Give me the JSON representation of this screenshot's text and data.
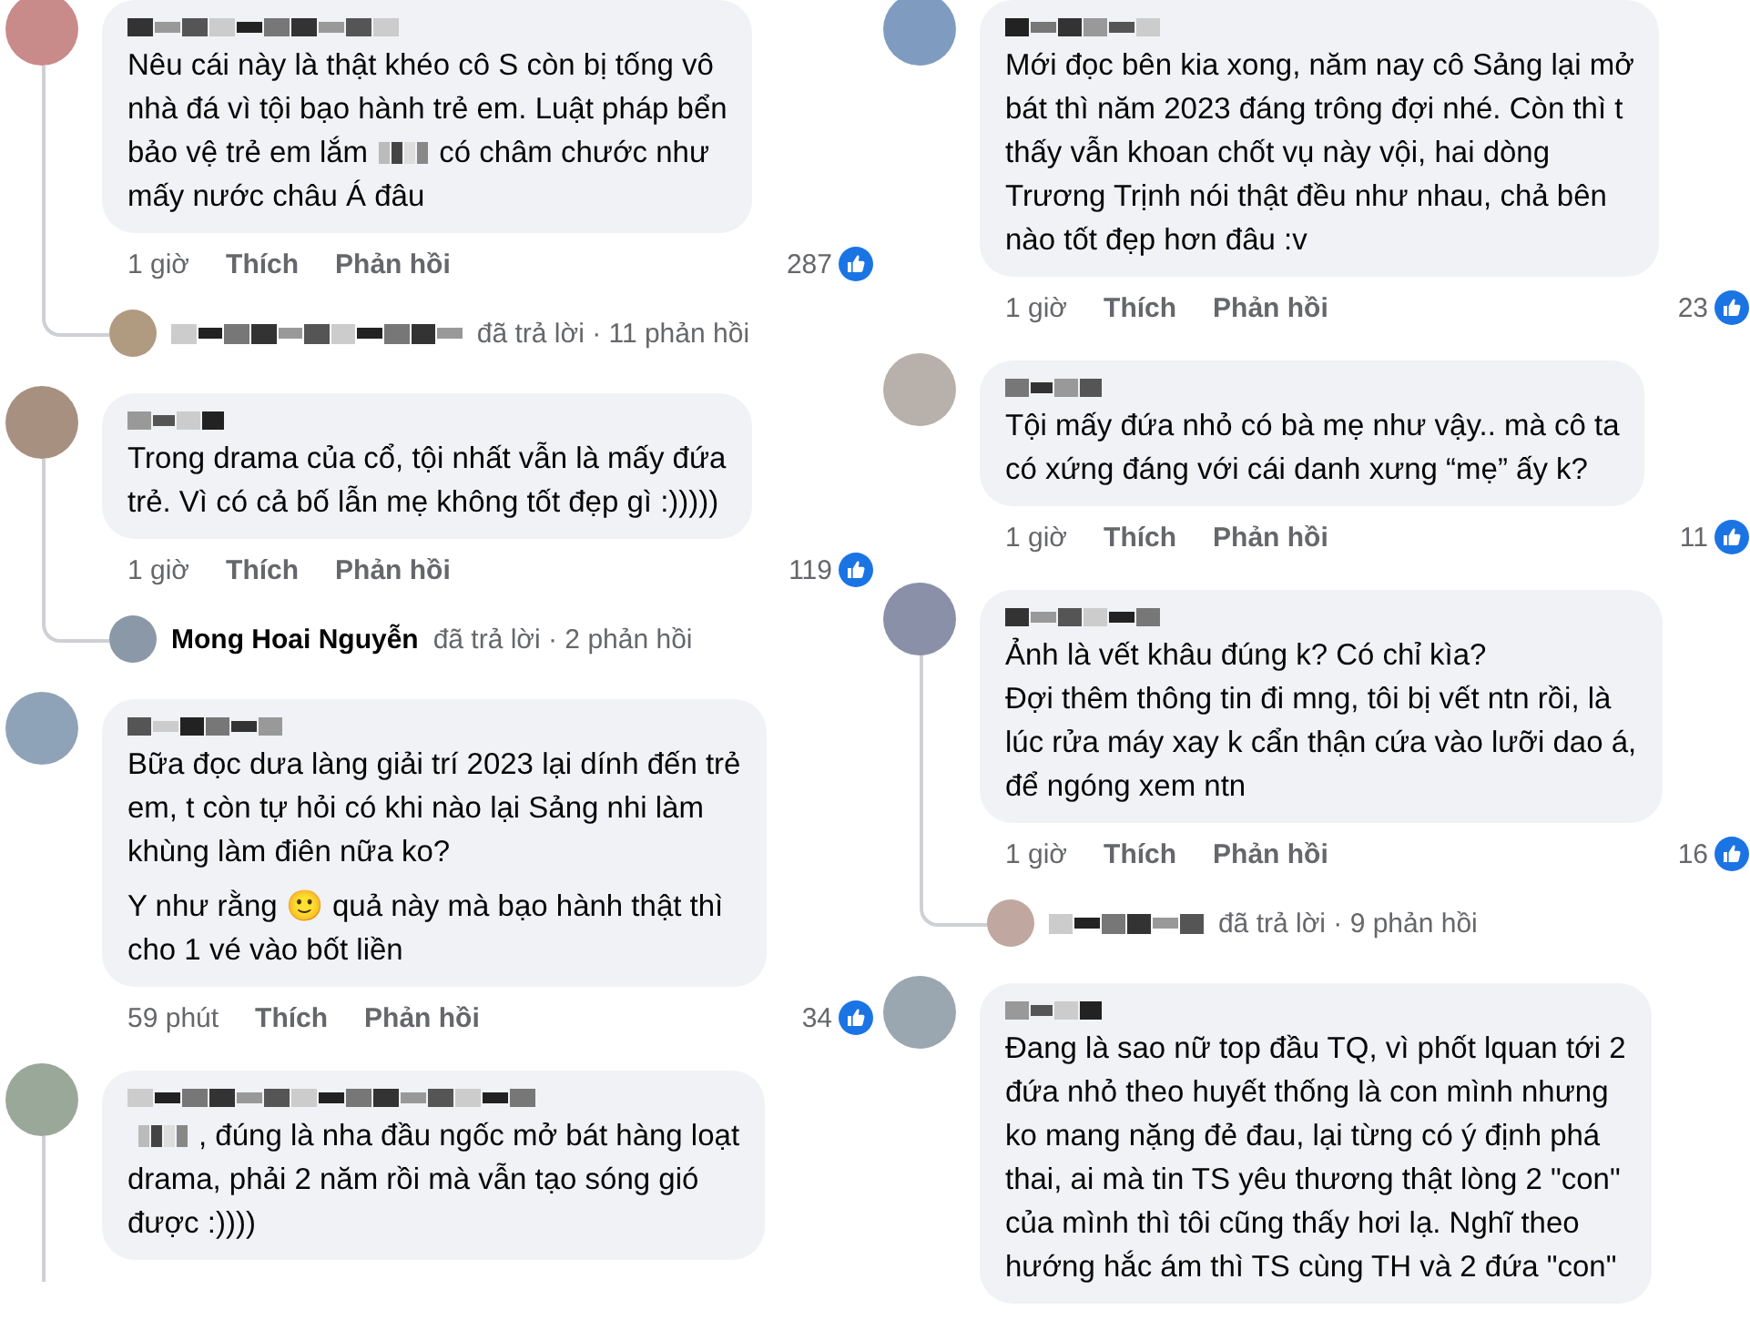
{
  "columns": [
    {
      "comments": [
        {
          "author": {
            "redacted": true
          },
          "paragraphs": [
            [
              {
                "kind": "text",
                "lines": [
                  "Nêu cái này là thật khéo cô S còn bị tống vô",
                  "nhà đá vì tội bạo hành trẻ em. Luật pháp bển"
                ]
              },
              {
                "kind": "row",
                "parts": [
                  {
                    "kind": "text",
                    "text": "bảo vệ trẻ em lắm"
                  },
                  {
                    "kind": "redacted"
                  },
                  {
                    "kind": "text",
                    "text": "có châm chước như"
                  }
                ]
              },
              {
                "kind": "text",
                "lines": [
                  "mấy nước châu Á đâu"
                ]
              }
            ]
          ],
          "time": "1 giờ",
          "actions": [
            "Thích",
            "Phản hồi"
          ],
          "likes": "287",
          "thread_line": true,
          "reply": {
            "author": {
              "redacted": true
            },
            "summary": "đã trả lời · 11 phản hồi"
          }
        },
        {
          "author": {
            "redacted": true
          },
          "paragraphs": [
            [
              {
                "kind": "text",
                "lines": [
                  "Trong drama của cổ, tội nhất vẫn là mấy đứa",
                  "trẻ. Vì có cả bố lẫn mẹ không tốt đẹp gì :)))))"
                ]
              }
            ]
          ],
          "time": "1 giờ",
          "actions": [
            "Thích",
            "Phản hồi"
          ],
          "likes": "119",
          "thread_line": true,
          "reply": {
            "author": {
              "name": "Mong Hoai Nguyễn"
            },
            "summary": "đã trả lời · 2 phản hồi"
          }
        },
        {
          "author": {
            "redacted": true
          },
          "paragraphs": [
            [
              {
                "kind": "text",
                "lines": [
                  "Bữa đọc dưa làng giải trí 2023 lại dính đến trẻ",
                  "em, t còn tự hỏi có khi nào lại Sảng nhi làm",
                  "khùng làm điên nữa ko?"
                ]
              }
            ],
            [
              {
                "kind": "text",
                "lines": [
                  "Y như rằng 🙂 quả này mà bạo hành thật thì",
                  "cho 1 vé vào bốt liền"
                ]
              }
            ]
          ],
          "time": "59 phút",
          "actions": [
            "Thích",
            "Phản hồi"
          ],
          "likes": "34",
          "thread_line": false
        },
        {
          "author": {
            "redacted": true
          },
          "paragraphs": [
            [
              {
                "kind": "row",
                "parts": [
                  {
                    "kind": "redacted"
                  },
                  {
                    "kind": "text",
                    "text": ", đúng là nha đầu ngốc mở bát hàng loạt"
                  }
                ]
              },
              {
                "kind": "text",
                "lines": [
                  "drama, phải 2 năm rồi mà vẫn tạo sóng gió",
                  "được :))))"
                ]
              }
            ]
          ],
          "thread_line": true
        }
      ]
    },
    {
      "comments": [
        {
          "author": {
            "redacted": true
          },
          "paragraphs": [
            [
              {
                "kind": "text",
                "lines": [
                  "Mới đọc bên kia xong, năm nay cô Sảng lại mở",
                  "bát thì năm 2023 đáng trông đợi nhé. Còn thì t",
                  "thấy vẫn khoan chốt vụ này vội, hai dòng",
                  "Trương Trịnh nói thật đều như nhau, chả bên",
                  "nào tốt đẹp hơn đâu :v"
                ]
              }
            ]
          ],
          "time": "1 giờ",
          "actions": [
            "Thích",
            "Phản hồi"
          ],
          "likes": "23",
          "thread_line": false
        },
        {
          "author": {
            "redacted": true
          },
          "paragraphs": [
            [
              {
                "kind": "text",
                "lines": [
                  "Tội mấy đứa nhỏ có bà mẹ như vậy.. mà cô ta",
                  "có xứng đáng với cái danh xưng “mẹ” ấy k?"
                ]
              }
            ]
          ],
          "time": "1 giờ",
          "actions": [
            "Thích",
            "Phản hồi"
          ],
          "likes": "11",
          "thread_line": false
        },
        {
          "author": {
            "redacted": true
          },
          "paragraphs": [
            [
              {
                "kind": "text",
                "lines": [
                  "Ảnh là vết khâu đúng k? Có chỉ kìa?",
                  "Đợi thêm thông tin đi mng, tôi bị vết ntn rồi, là",
                  "lúc rửa máy xay k cẩn thận cứa vào lưỡi dao á,",
                  "để ngóng xem ntn"
                ]
              }
            ]
          ],
          "time": "1 giờ",
          "actions": [
            "Thích",
            "Phản hồi"
          ],
          "likes": "16",
          "thread_line": true,
          "reply": {
            "author": {
              "redacted": true
            },
            "summary": "đã trả lời · 9 phản hồi"
          }
        },
        {
          "author": {
            "redacted": true
          },
          "paragraphs": [
            [
              {
                "kind": "text",
                "lines": [
                  "Đang là sao nữ top đầu TQ, vì phốt lquan tới 2",
                  "đứa nhỏ theo huyết thống là con mình nhưng",
                  "ko mang nặng đẻ đau, lại từng có ý định phá",
                  "thai, ai mà tin TS yêu thương thật lòng 2 \"con\"",
                  "của mình thì tôi cũng thấy hơi lạ. Nghĩ theo",
                  "hướng hắc ám thì TS cùng TH và 2 đứa \"con\""
                ]
              }
            ]
          ],
          "thread_line": false
        }
      ]
    }
  ]
}
